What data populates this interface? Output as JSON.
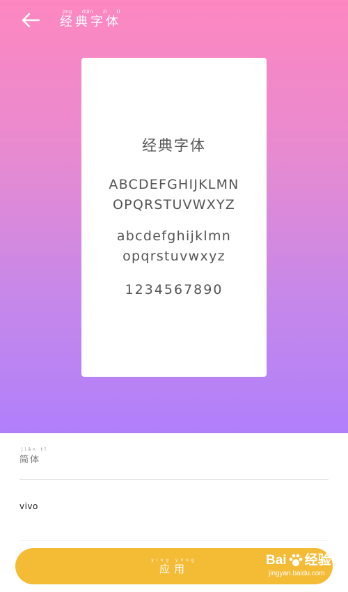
{
  "header": {
    "title_pinyin": [
      "jīng",
      "diǎn",
      "zì",
      "tǐ"
    ],
    "title": "经典字体"
  },
  "preview": {
    "title": "经典字体",
    "uppercase_line1": "ABCDEFGHIJKLMN",
    "uppercase_line2": "OPQRSTUVWXYZ",
    "lowercase_line1": "abcdefghijklmn",
    "lowercase_line2": "opqrstuvwxyz",
    "digits": "1234567890"
  },
  "list": {
    "simplified_pinyin": "jiǎn tǐ",
    "simplified_label": "简体",
    "vivo_label": "vivo"
  },
  "apply_button": {
    "pinyin": "yìng yòng",
    "label": "应用"
  },
  "watermark": {
    "brand_left": "Bai",
    "brand_right": "经验",
    "url": "jingyan.baidu.com"
  },
  "colors": {
    "gradient_top": "#fd87c0",
    "gradient_bottom": "#b17ffb",
    "button": "#f4bb35"
  }
}
